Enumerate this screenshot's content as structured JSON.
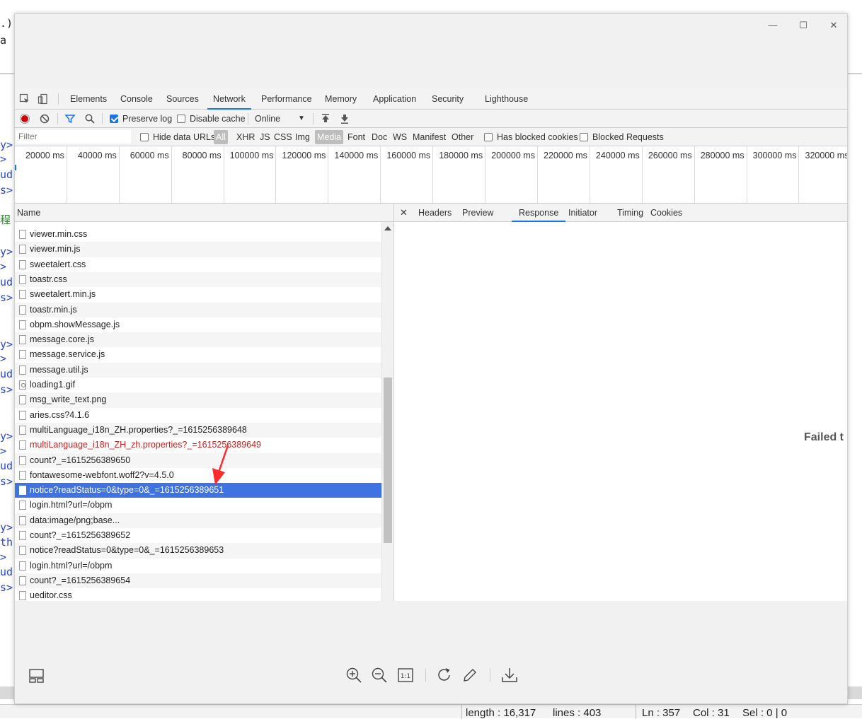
{
  "background": {
    "code_fragments": [
      ".)",
      "a",
      "y>",
      ">",
      "ud",
      "s>",
      "程",
      "y>",
      ">",
      "ud",
      "s>",
      "y>",
      ">",
      "ud",
      "s>",
      "y>",
      ">",
      "ud",
      "s>",
      "y>",
      "th",
      ">",
      "ud",
      "s>"
    ],
    "status": {
      "length": "length : 16,317",
      "lines": "lines : 403",
      "ln": "Ln : 357",
      "col": "Col : 31",
      "sel": "Sel : 0 | 0"
    }
  },
  "window_controls": {
    "minimize": "—",
    "maximize": "☐",
    "close": "✕"
  },
  "devtools": {
    "tabs": [
      "Elements",
      "Console",
      "Sources",
      "Network",
      "Performance",
      "Memory",
      "Application",
      "Security",
      "Lighthouse"
    ],
    "active_tab": "Network",
    "toolbar": {
      "preserve_log": "Preserve log",
      "disable_cache": "Disable cache",
      "throttle": "Online",
      "preserve_log_checked": true,
      "disable_cache_checked": false
    },
    "filterbar": {
      "placeholder": "Filter",
      "hide_data_urls": "Hide data URLs",
      "types": [
        "All",
        "XHR",
        "JS",
        "CSS",
        "Img",
        "Media",
        "Font",
        "Doc",
        "WS",
        "Manifest",
        "Other"
      ],
      "has_blocked_cookies": "Has blocked cookies",
      "blocked_requests": "Blocked Requests"
    },
    "overview_ticks": [
      "20000 ms",
      "40000 ms",
      "60000 ms",
      "80000 ms",
      "100000 ms",
      "120000 ms",
      "140000 ms",
      "160000 ms",
      "180000 ms",
      "200000 ms",
      "220000 ms",
      "240000 ms",
      "260000 ms",
      "280000 ms",
      "300000 ms",
      "320000 ms"
    ],
    "name_header": "Name",
    "requests": [
      {
        "name": "viewer.min.css",
        "icon": "file"
      },
      {
        "name": "viewer.min.js",
        "icon": "file"
      },
      {
        "name": "sweetalert.css",
        "icon": "file"
      },
      {
        "name": "toastr.css",
        "icon": "file"
      },
      {
        "name": "sweetalert.min.js",
        "icon": "file"
      },
      {
        "name": "toastr.min.js",
        "icon": "file"
      },
      {
        "name": "obpm.showMessage.js",
        "icon": "file"
      },
      {
        "name": "message.core.js",
        "icon": "file"
      },
      {
        "name": "message.service.js",
        "icon": "file"
      },
      {
        "name": "message.util.js",
        "icon": "file"
      },
      {
        "name": "loading1.gif",
        "icon": "image"
      },
      {
        "name": "msg_write_text.png",
        "icon": "file"
      },
      {
        "name": "aries.css?4.1.6",
        "icon": "file"
      },
      {
        "name": "multiLanguage_i18n_ZH.properties?_=1615256389648",
        "icon": "file"
      },
      {
        "name": "multiLanguage_i18n_ZH_zh.properties?_=1615256389649",
        "icon": "file",
        "status": "error"
      },
      {
        "name": "count?_=1615256389650",
        "icon": "file"
      },
      {
        "name": "fontawesome-webfont.woff2?v=4.5.0",
        "icon": "file"
      },
      {
        "name": "notice?readStatus=0&type=0&_=1615256389651",
        "icon": "file",
        "status": "selected"
      },
      {
        "name": "login.html?url=/obpm",
        "icon": "file"
      },
      {
        "name": "data:image/png;base...",
        "icon": "file"
      },
      {
        "name": "count?_=1615256389652",
        "icon": "file"
      },
      {
        "name": "notice?readStatus=0&type=0&_=1615256389653",
        "icon": "file"
      },
      {
        "name": "login.html?url=/obpm",
        "icon": "file"
      },
      {
        "name": "count?_=1615256389654",
        "icon": "file"
      },
      {
        "name": "ueditor.css",
        "icon": "file"
      }
    ],
    "detail_tabs": [
      "Headers",
      "Preview",
      "Response",
      "Initiator",
      "Timing",
      "Cookies"
    ],
    "active_detail_tab": "Response",
    "close_glyph": "✕",
    "response_message": "Failed t"
  },
  "colors": {
    "accent": "#1a73e8",
    "selected_row": "#3f73e2",
    "error_text": "#c5221f",
    "arrow": "#ff2a2a"
  }
}
